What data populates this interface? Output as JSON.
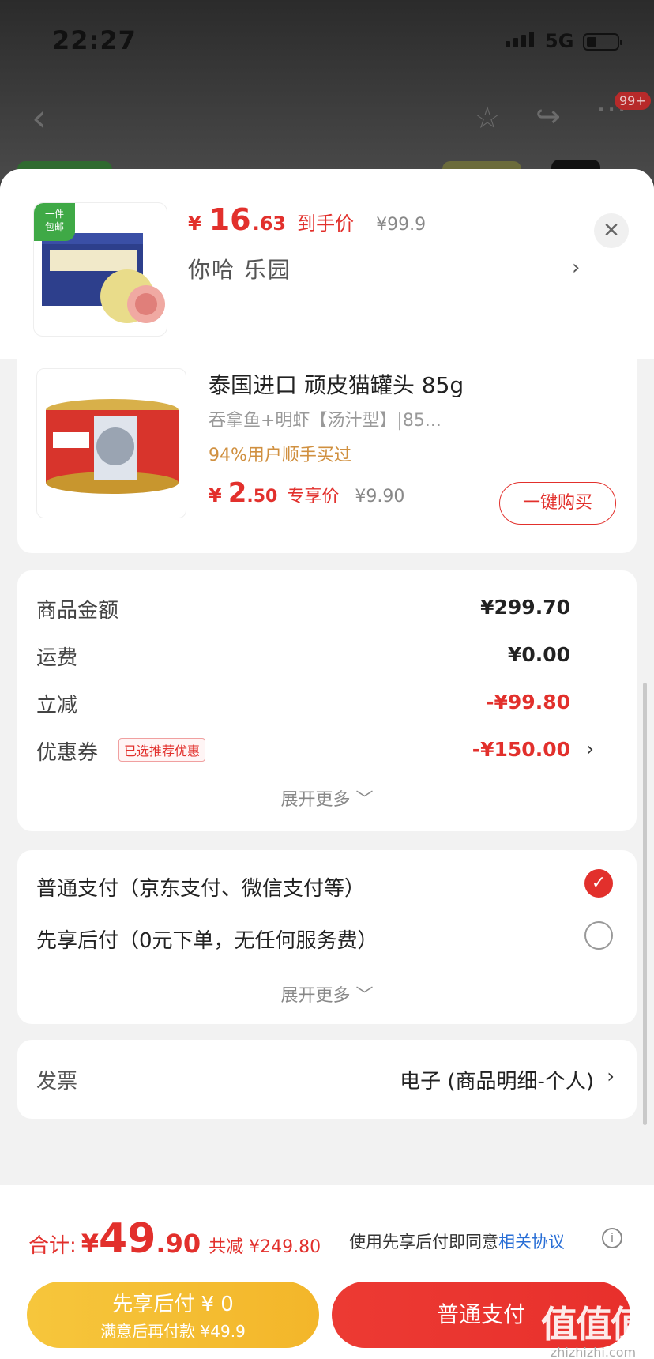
{
  "status_bar": {
    "time": "22:27",
    "network": "5G"
  },
  "nav": {
    "badge": "99+"
  },
  "header": {
    "thumb_tag": "一件\n包邮",
    "price_yen": "¥",
    "price_int": "16",
    "price_dec": ".63",
    "price_label": "到手价",
    "price_orig": "¥99.9",
    "name": "你哈  乐园"
  },
  "product": {
    "title": "泰国进口 顽皮猫罐头 85g",
    "spec": "吞拿鱼+明虾【汤汁型】|85...",
    "social": "94%用户顺手买过",
    "price_yen": "¥",
    "price_int": "2",
    "price_dec": ".50",
    "price_label": "专享价",
    "price_orig": "¥9.90",
    "buy_label": "一键购买"
  },
  "summary": {
    "rows": [
      {
        "label": "商品金额",
        "value": "¥299.70"
      },
      {
        "label": "运费",
        "value": "¥0.00"
      },
      {
        "label": "立减",
        "value": "-¥99.80"
      },
      {
        "label": "优惠券",
        "value": "-¥150.00",
        "badge": "已选推荐优惠"
      }
    ],
    "expand": "展开更多 ﹀"
  },
  "payment": {
    "options": [
      {
        "label": "普通支付（京东支付、微信支付等）",
        "checked": true
      },
      {
        "label": "先享后付（0元下单，无任何服务费）",
        "checked": false
      }
    ],
    "expand": "展开更多 ﹀"
  },
  "invoice": {
    "label": "发票",
    "value": "电子 (商品明细-个人)"
  },
  "bottom": {
    "total_label": "合计:",
    "total_yen": "¥",
    "total_int": "49",
    "total_dec": ".90",
    "total_saved": "共减 ¥249.80",
    "agree_prefix": "使用先享后付即同意",
    "agree_link": "相关协议",
    "later_main": "先享后付 ¥ 0",
    "later_sub": "满意后再付款 ¥49.9",
    "pay_label": "普通支付"
  },
  "watermark": {
    "main": "值值值",
    "sub": "zhizhizhi.com"
  },
  "colors": {
    "accent": "#e2302c",
    "yellow": "#f6c63c",
    "link": "#2a6fd6",
    "social": "#d09040"
  }
}
